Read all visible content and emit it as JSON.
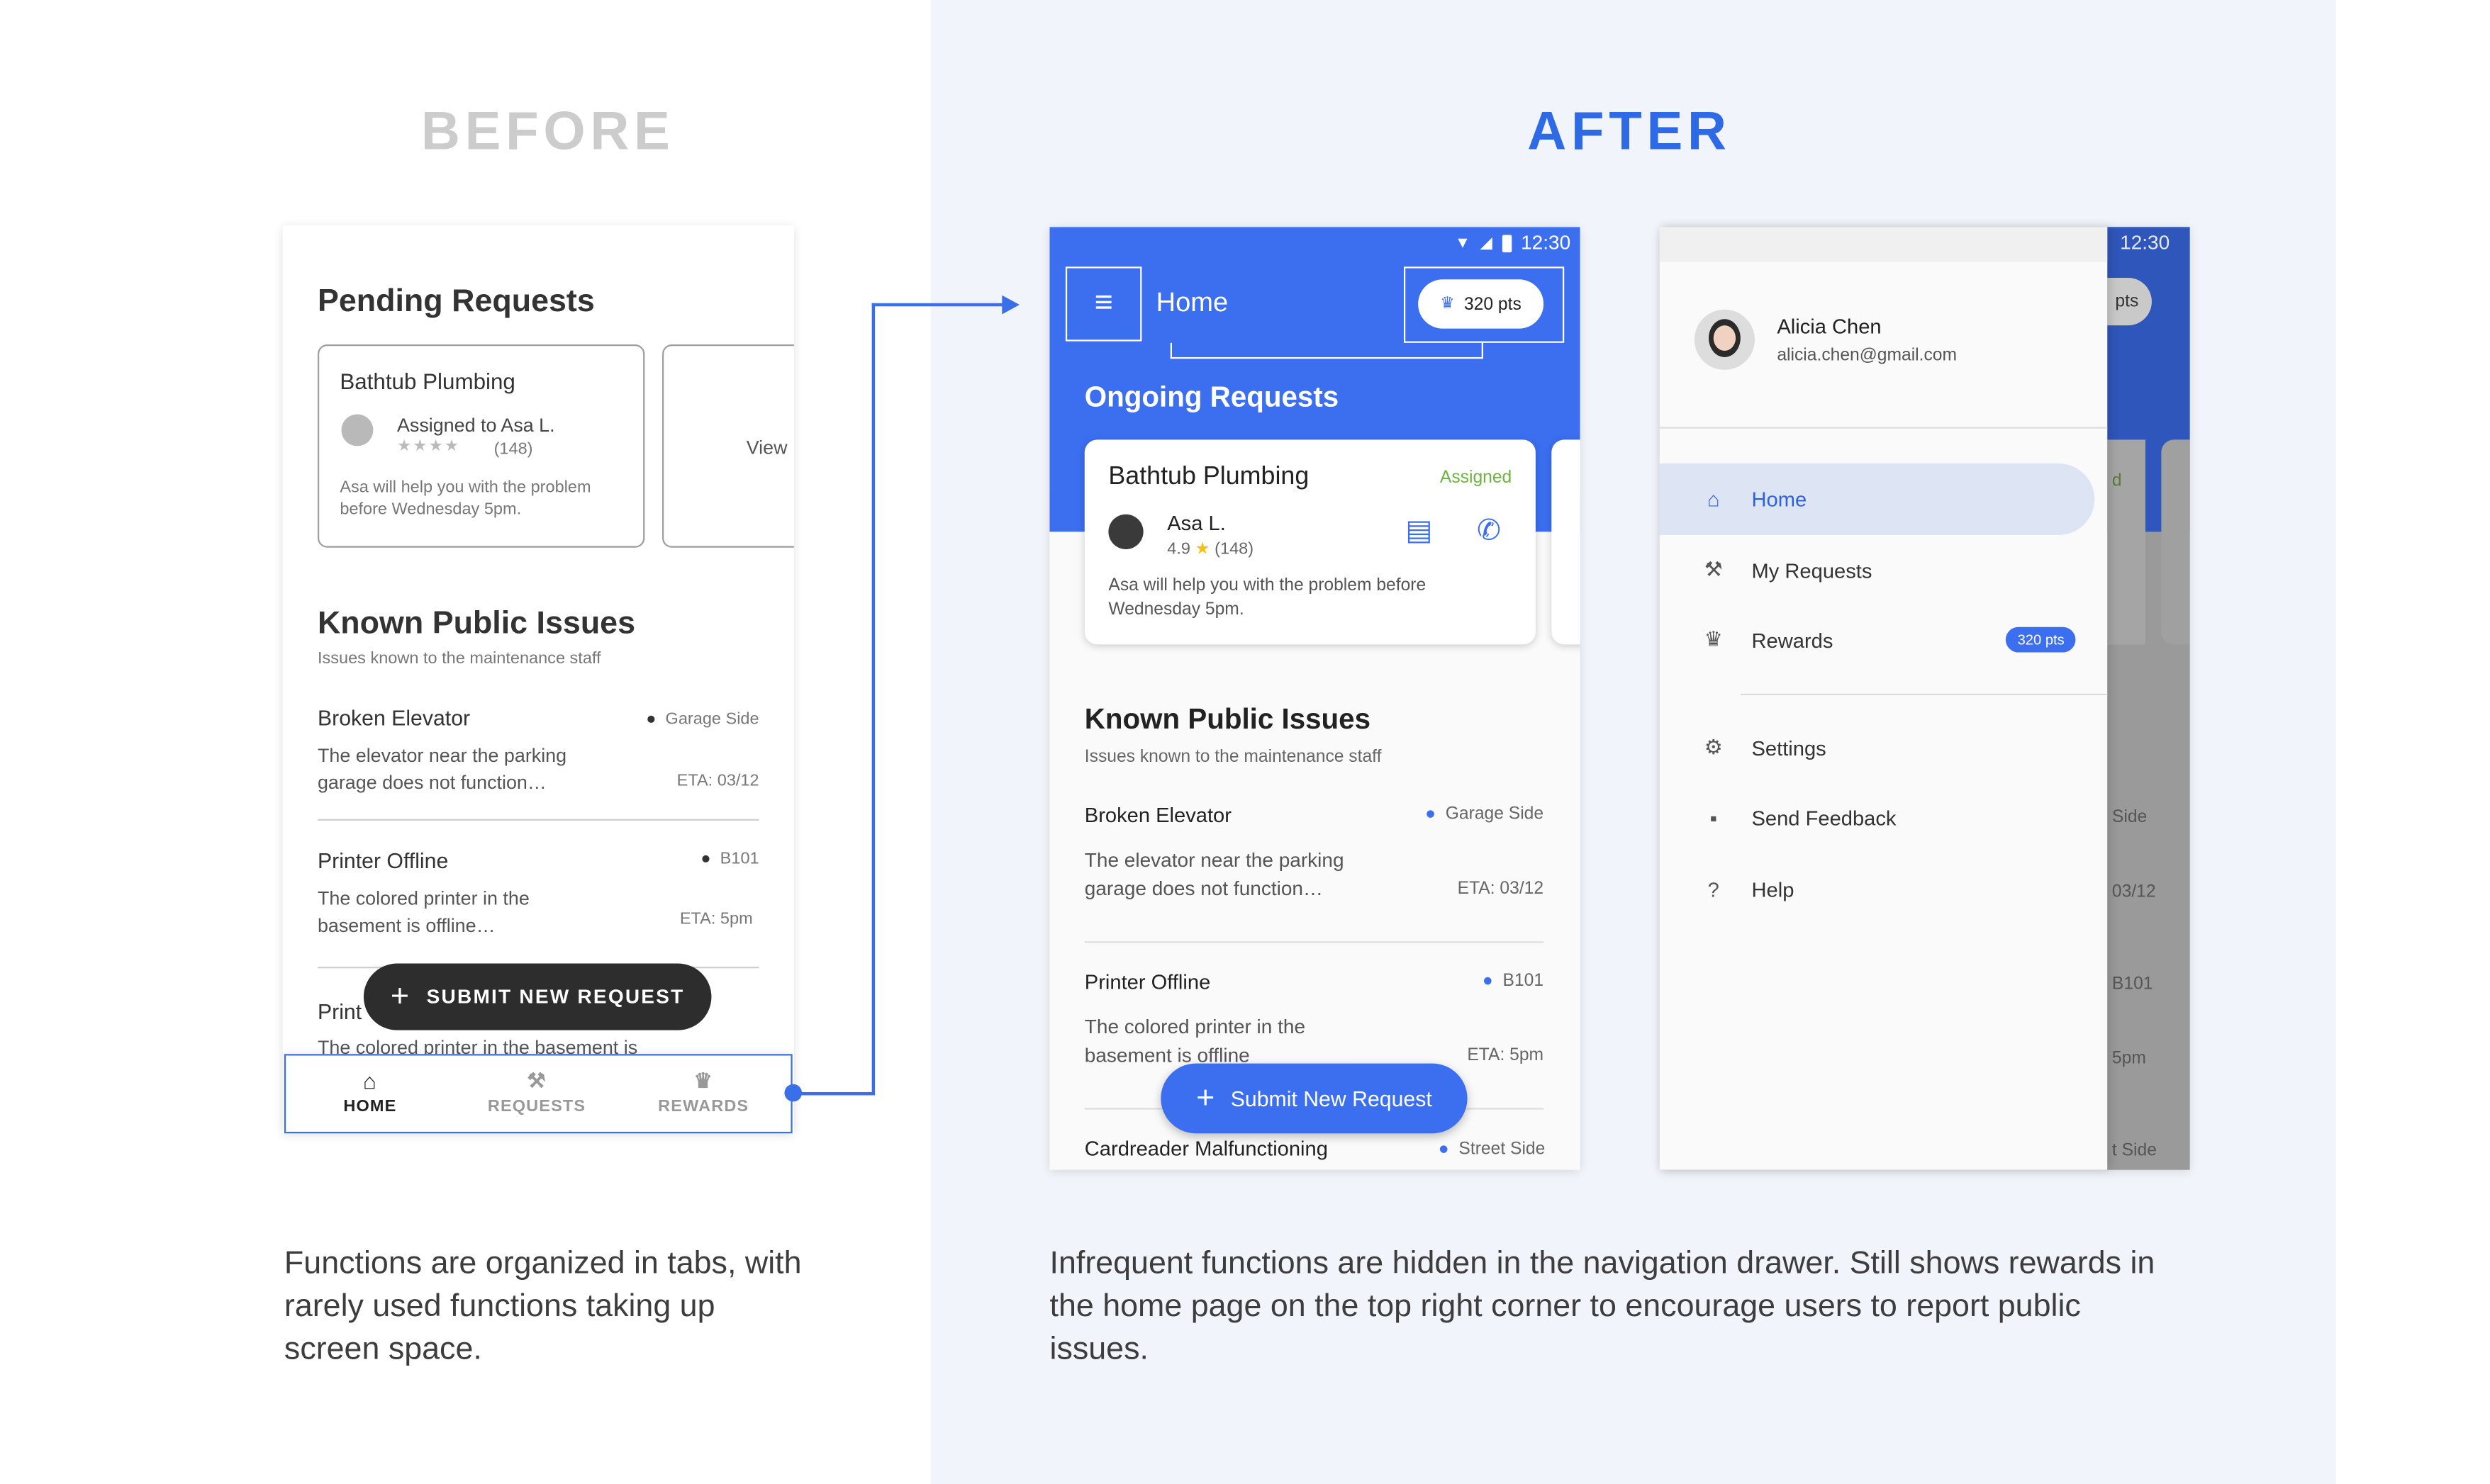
{
  "headings": {
    "before": "BEFORE",
    "after": "AFTER"
  },
  "captions": {
    "before": "Functions are organized in tabs, with rarely used functions taking up screen space.",
    "after": "Infrequent functions are hidden in the navigation drawer. Still shows rewards in the home page on the top right corner to encourage users to report public issues."
  },
  "colors": {
    "brand_blue": "#3b6ff0",
    "before_heading": "#cccccc",
    "assigned_green": "#6db33f"
  },
  "before": {
    "pending_title": "Pending Requests",
    "card": {
      "title": "Bathtub Plumbing",
      "assignee": "Assigned to Asa L.",
      "reviews": "(148)",
      "rating_stars": 4,
      "description": "Asa will help you with the problem before Wednesday 5pm."
    },
    "view_label": "View",
    "public_title": "Known Public Issues",
    "public_subtitle": "Issues known to the maintenance staff",
    "issues": [
      {
        "title": "Broken Elevator",
        "location": "Garage Side",
        "desc": "The elevator near the parking garage does not function…",
        "eta": "ETA: 03/12"
      },
      {
        "title": "Printer Offline",
        "location": "B101",
        "desc": "The colored printer in the basement is offline…",
        "eta": "ETA: 5pm"
      },
      {
        "title": "Print",
        "desc": "The colored printer in the basement is"
      }
    ],
    "fab_label": "SUBMIT NEW REQUEST",
    "nav": [
      {
        "label": "HOME",
        "icon": "home-icon"
      },
      {
        "label": "REQUESTS",
        "icon": "tools-icon"
      },
      {
        "label": "REWARDS",
        "icon": "trophy-icon"
      }
    ]
  },
  "after": {
    "status_time": "12:30",
    "appbar_title": "Home",
    "points": "320 pts",
    "ongoing_title": "Ongoing Requests",
    "card": {
      "title": "Bathtub Plumbing",
      "status": "Assigned",
      "assignee": "Asa L.",
      "rating": "4.9",
      "reviews": "(148)",
      "description": "Asa will help you with the problem before Wednesday 5pm."
    },
    "public_title": "Known Public Issues",
    "public_subtitle": "Issues known to the maintenance staff",
    "issues": [
      {
        "title": "Broken Elevator",
        "location": "Garage Side",
        "desc": "The elevator near the parking garage does not function…",
        "eta": "ETA: 03/12"
      },
      {
        "title": "Printer Offline",
        "location": "B101",
        "desc": "The colored printer in the basement is offline",
        "eta": "ETA: 5pm"
      },
      {
        "title": "Cardreader Malfunctioning",
        "location": "Street Side"
      }
    ],
    "fab_label": "Submit New Request"
  },
  "drawer": {
    "status_time": "12:30",
    "user_name": "Alicia Chen",
    "user_email": "alicia.chen@gmail.com",
    "items": [
      {
        "label": "Home",
        "icon": "home-icon",
        "active": true
      },
      {
        "label": "My Requests",
        "icon": "tools-icon"
      },
      {
        "label": "Rewards",
        "icon": "trophy-icon",
        "badge": "320 pts"
      },
      {
        "label": "Settings",
        "icon": "gear-icon"
      },
      {
        "label": "Send Feedback",
        "icon": "feedback-icon"
      },
      {
        "label": "Help",
        "icon": "help-icon"
      }
    ],
    "peek": {
      "pts": "pts",
      "d": "d",
      "side1": "Side",
      "eta1": "03/12",
      "b101": "B101",
      "eta2": "5pm",
      "side2": "t Side"
    }
  }
}
